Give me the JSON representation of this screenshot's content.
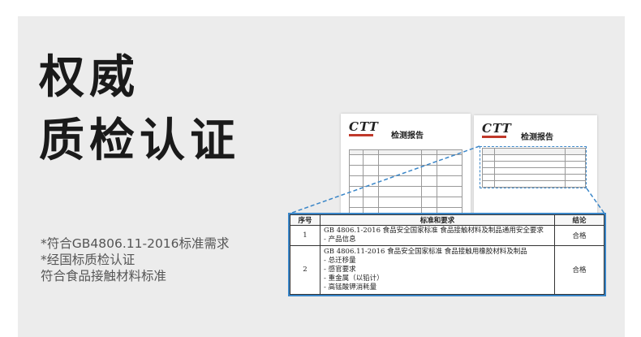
{
  "headline": {
    "line1": "权威",
    "line2": "质检认证"
  },
  "notes": [
    "*符合GB4806.11-2016标准需求",
    "*经国标质检认证",
    " 符合食品接触材料标准"
  ],
  "report_thumbnails": [
    {
      "logo": "CTT",
      "title": "检测报告"
    },
    {
      "logo": "CTT",
      "title": "检测报告"
    }
  ],
  "colors": {
    "highlight": "#3a86c8",
    "background": "#ececec",
    "headline": "#1a1a1a"
  },
  "table": {
    "headers": [
      "序号",
      "标准和要求",
      "结论"
    ],
    "rows": [
      {
        "no": "1",
        "standard": "GB 4806.1-2016 食品安全国家标准 食品接触材料及制品通用安全要求",
        "items": [
          "- 产品信息"
        ],
        "result": "合格"
      },
      {
        "no": "2",
        "standard": "GB 4806.11-2016 食品安全国家标准 食品接触用橡胶材料及制品",
        "items": [
          "- 总迁移量",
          "- 感官要求",
          "- 重金属（以铅计）",
          "- 高锰酸钾消耗量"
        ],
        "result": "合格"
      }
    ]
  }
}
